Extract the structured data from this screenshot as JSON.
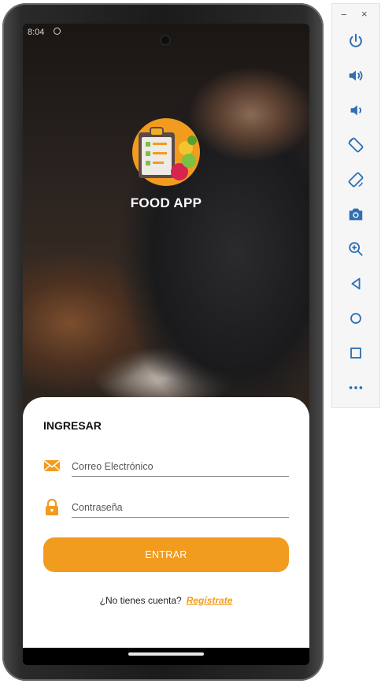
{
  "status": {
    "time": "8:04"
  },
  "app": {
    "title": "FOOD APP"
  },
  "login": {
    "heading": "INGRESAR",
    "email_placeholder": "Correo Electrónico",
    "password_placeholder": "Contraseña",
    "submit_label": "ENTRAR",
    "no_account_text": "¿No tienes cuenta?",
    "register_link": "Regístrate"
  },
  "colors": {
    "accent": "#f19b1f",
    "card": "#ffffff",
    "sidebar": "#f6f6f6",
    "sidebar_icon": "#2f6fb3"
  },
  "emulator": {
    "window_controls": {
      "minimize": "−",
      "close": "×"
    },
    "buttons": [
      "power-icon",
      "volume-up-icon",
      "volume-down-icon",
      "rotate-left-icon",
      "rotate-right-icon",
      "camera-icon",
      "zoom-icon",
      "back-icon",
      "home-icon",
      "overview-icon",
      "more-icon"
    ]
  }
}
